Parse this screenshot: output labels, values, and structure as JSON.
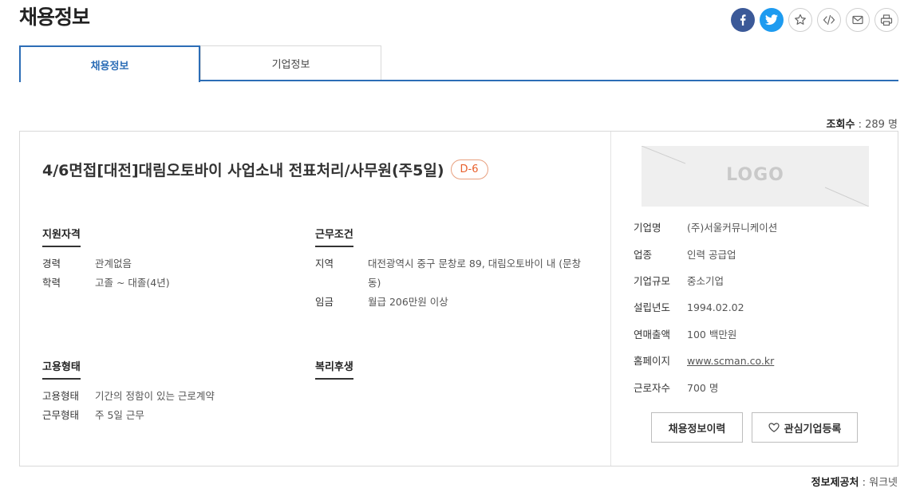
{
  "page": {
    "title": "채용정보"
  },
  "tabs": [
    {
      "label": "채용정보",
      "active": true
    },
    {
      "label": "기업정보",
      "active": false
    }
  ],
  "views": {
    "label": "조회수",
    "value": "289 명"
  },
  "job": {
    "title": "4/6면접[대전]대림오토바이 사업소내 전표처리/사무원(주5일)",
    "dday": "D-6"
  },
  "qualification": {
    "heading": "지원자격",
    "rows": [
      {
        "key": "경력",
        "value": "관계없음"
      },
      {
        "key": "학력",
        "value": "고졸 ~ 대졸(4년)"
      }
    ]
  },
  "conditions": {
    "heading": "근무조건",
    "rows": [
      {
        "key": "지역",
        "value": "대전광역시 중구 문창로 89, 대림오토바이 내 (문창동)"
      },
      {
        "key": "임금",
        "value": "월급 206만원 이상"
      }
    ]
  },
  "employment": {
    "heading": "고용형태",
    "rows": [
      {
        "key": "고용형태",
        "value": "기간의 정함이 있는 근로계약"
      },
      {
        "key": "근무형태",
        "value": "주 5일 근무"
      }
    ]
  },
  "welfare": {
    "heading": "복리후생"
  },
  "company": {
    "logo_text": "LOGO",
    "rows": [
      {
        "key": "기업명",
        "value": "(주)서울커뮤니케이션"
      },
      {
        "key": "업종",
        "value": "인력 공급업"
      },
      {
        "key": "기업규모",
        "value": "중소기업"
      },
      {
        "key": "설립년도",
        "value": "1994.02.02"
      },
      {
        "key": "연매출액",
        "value": "100 백만원"
      },
      {
        "key": "홈페이지",
        "value": "www.scman.co.kr"
      },
      {
        "key": "근로자수",
        "value": "700 명"
      }
    ],
    "btn_history": "채용정보이력",
    "btn_interest": "관심기업등록"
  },
  "source": {
    "label": "정보제공처",
    "value": "워크넷"
  },
  "colors": {
    "accent": "#2c6db6",
    "dday": "#e8602c",
    "facebook": "#3b5998",
    "twitter": "#1d9bf0"
  }
}
